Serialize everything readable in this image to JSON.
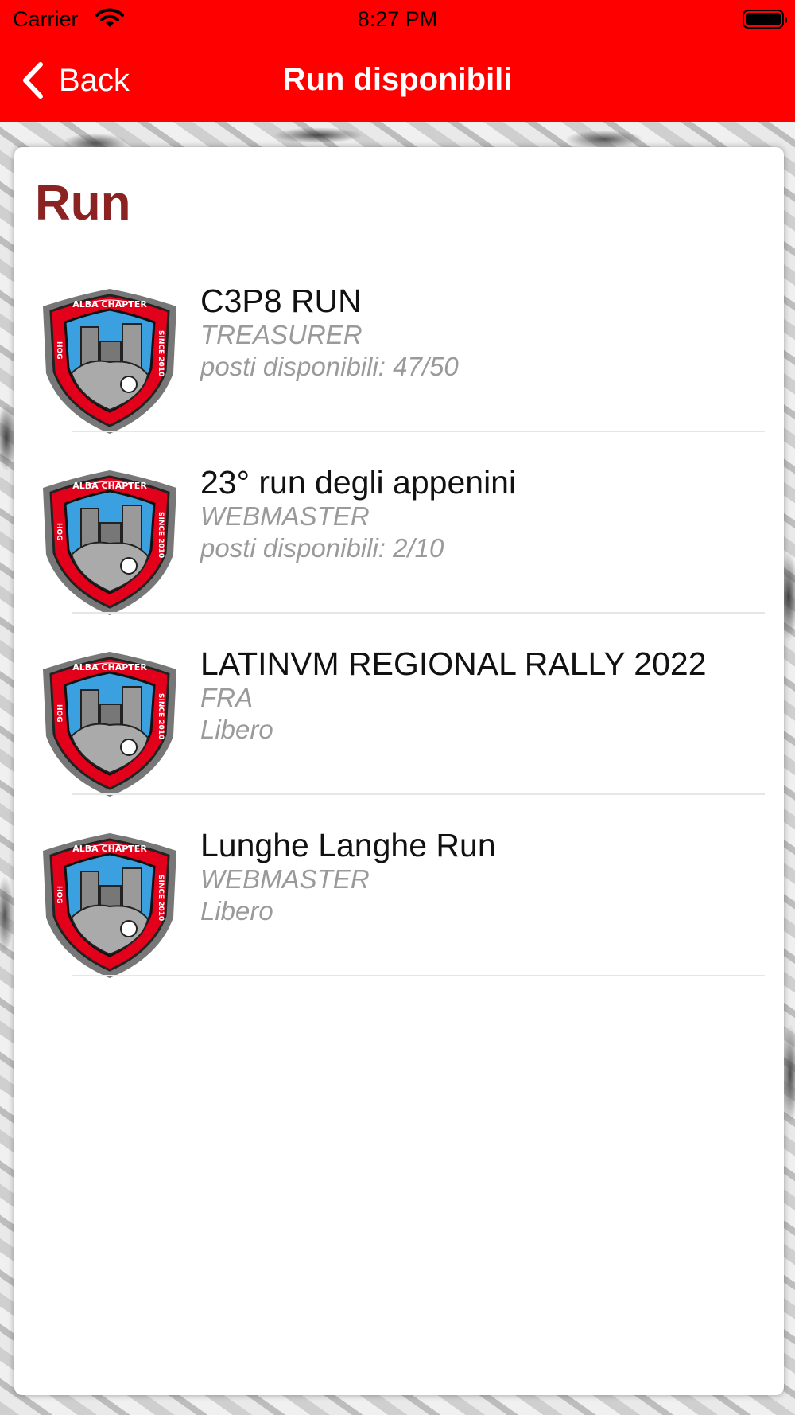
{
  "status_bar": {
    "carrier": "Carrier",
    "time": "8:27 PM"
  },
  "nav": {
    "back_label": "Back",
    "title": "Run disponibili",
    "color": "#ff0000"
  },
  "section": {
    "title": "Run",
    "color": "#8b2323"
  },
  "runs": [
    {
      "title": "C3P8 RUN",
      "role": "TREASURER",
      "seats": "posti disponibili: 47/50"
    },
    {
      "title": "23° run degli appenini",
      "role": "WEBMASTER",
      "seats": "posti disponibili: 2/10"
    },
    {
      "title": "LATINVM REGIONAL RALLY 2022",
      "role": "FRA",
      "seats": "Libero"
    },
    {
      "title": "Lunghe Langhe Run",
      "role": "WEBMASTER",
      "seats": "Libero"
    }
  ],
  "badge": {
    "top_text": "ALBA CHAPTER",
    "left_text": "HOG",
    "right_text": "SINCE 2010"
  },
  "icons": {
    "back": "chevron-left-icon",
    "wifi": "wifi-icon",
    "battery": "battery-icon",
    "logo": "chapter-badge-icon"
  }
}
